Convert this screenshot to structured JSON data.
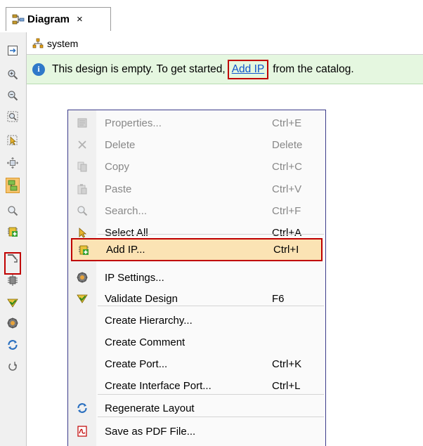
{
  "tab": {
    "title": "Diagram",
    "close": "×"
  },
  "breadcrumb": {
    "label": "system"
  },
  "infobar": {
    "prefix": "This design is empty. To get started,",
    "link": "Add IP",
    "suffix": "from the catalog."
  },
  "toolbar": {
    "items": [
      {
        "icon": "fit-to-window-icon"
      },
      {
        "icon": "zoom-in-icon"
      },
      {
        "icon": "zoom-out-icon"
      },
      {
        "icon": "zoom-area-icon"
      },
      {
        "icon": "select-area-icon"
      },
      {
        "icon": "expand-icon"
      },
      {
        "icon": "auto-connect-icon",
        "active": true
      },
      {
        "icon": "search-icon"
      },
      {
        "icon": "add-ip-icon",
        "highlighted": true
      },
      {
        "icon": "route-icon"
      },
      {
        "icon": "optimize-icon"
      },
      {
        "icon": "validate-design-icon"
      },
      {
        "icon": "ip-settings-icon"
      },
      {
        "icon": "regenerate-layout-icon"
      },
      {
        "icon": "reload-icon"
      }
    ]
  },
  "context_menu": {
    "items": [
      {
        "label": "Properties...",
        "shortcut": "Ctrl+E",
        "icon": "properties-icon",
        "disabled": true
      },
      {
        "label": "Delete",
        "shortcut": "Delete",
        "icon": "delete-icon",
        "disabled": true
      },
      {
        "label": "Copy",
        "shortcut": "Ctrl+C",
        "icon": "copy-icon",
        "disabled": true
      },
      {
        "label": "Paste",
        "shortcut": "Ctrl+V",
        "icon": "paste-icon",
        "disabled": true
      },
      {
        "label": "Search...",
        "shortcut": "Ctrl+F",
        "icon": "search-icon",
        "disabled": true
      },
      {
        "label": "Select All",
        "shortcut": "Ctrl+A",
        "icon": "select-all-icon"
      },
      {
        "label": "Add IP...",
        "shortcut": "Ctrl+I",
        "icon": "add-ip-icon",
        "highlighted": true
      },
      {
        "label": "IP Settings...",
        "shortcut": "",
        "icon": "ip-settings-icon"
      },
      {
        "label": "Validate Design",
        "shortcut": "F6",
        "icon": "validate-design-icon"
      },
      {
        "label": "Create Hierarchy...",
        "shortcut": ""
      },
      {
        "label": "Create Comment",
        "shortcut": ""
      },
      {
        "label": "Create Port...",
        "shortcut": "Ctrl+K"
      },
      {
        "label": "Create Interface Port...",
        "shortcut": "Ctrl+L"
      },
      {
        "label": "Regenerate Layout",
        "shortcut": "",
        "icon": "regenerate-layout-icon"
      },
      {
        "label": "Save as PDF File...",
        "shortcut": "",
        "icon": "pdf-icon"
      }
    ]
  },
  "colors": {
    "highlight_border": "#c00000",
    "infobar_bg": "#e5f7e0",
    "menu_highlight_bg": "#fbe3b4",
    "link": "#1155cc"
  }
}
